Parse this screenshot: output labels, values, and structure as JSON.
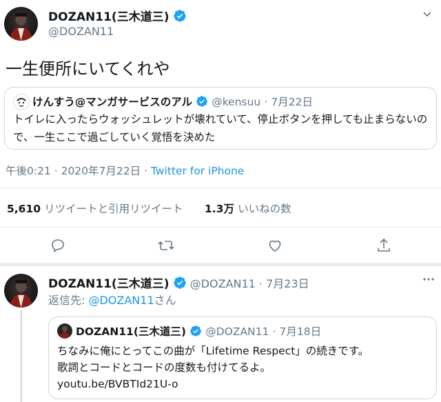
{
  "tweet": {
    "author_name": "DOZAN11(三木道三)",
    "author_handle": "@DOZAN11",
    "text": "一生便所にいてくれや",
    "quoted": {
      "name": "けんすう@マンガサービスのアル",
      "handle": "@kensuu",
      "sep": "·",
      "date": "7月22日",
      "text": "トイレに入ったらウォッシュレットが壊れていて、停止ボタンを押しても止まらないので、一生ここで過ごしていく覚悟を決めた"
    },
    "timestamp": "午後0:21 · 2020年7月22日 · ",
    "source": "Twitter for iPhone",
    "stats": {
      "retweets_count": "5,610",
      "retweets_label": "リツイートと引用リツイート",
      "likes_count": "1.3万",
      "likes_label": "いいねの数"
    }
  },
  "reply": {
    "author_name": "DOZAN11(三木道三)",
    "author_handle": "@DOZAN11",
    "sep": "·",
    "date": "7月23日",
    "reply_prefix": "返信先: ",
    "reply_to": "@DOZAN11",
    "reply_suffix": "さん",
    "quoted": {
      "name": "DOZAN11(三木道三)",
      "handle": "@DOZAN11",
      "sep": "·",
      "date": "7月18日",
      "line1": "ちなみに俺にとってこの曲が「Lifetime Respect」の続きです。",
      "line2": "歌詞とコードとコードの度数も付けてるよ。",
      "link": "youtu.be/BVBTId21U-o"
    }
  },
  "icons": [
    "verified-badge-icon",
    "more-icon",
    "reply-icon",
    "retweet-icon",
    "like-icon",
    "share-icon",
    "caret-down-icon"
  ],
  "colors": {
    "verified": "#1da1f2",
    "link": "#1b95e0",
    "secondary_text": "#657786",
    "border": "#ccd6dd"
  }
}
